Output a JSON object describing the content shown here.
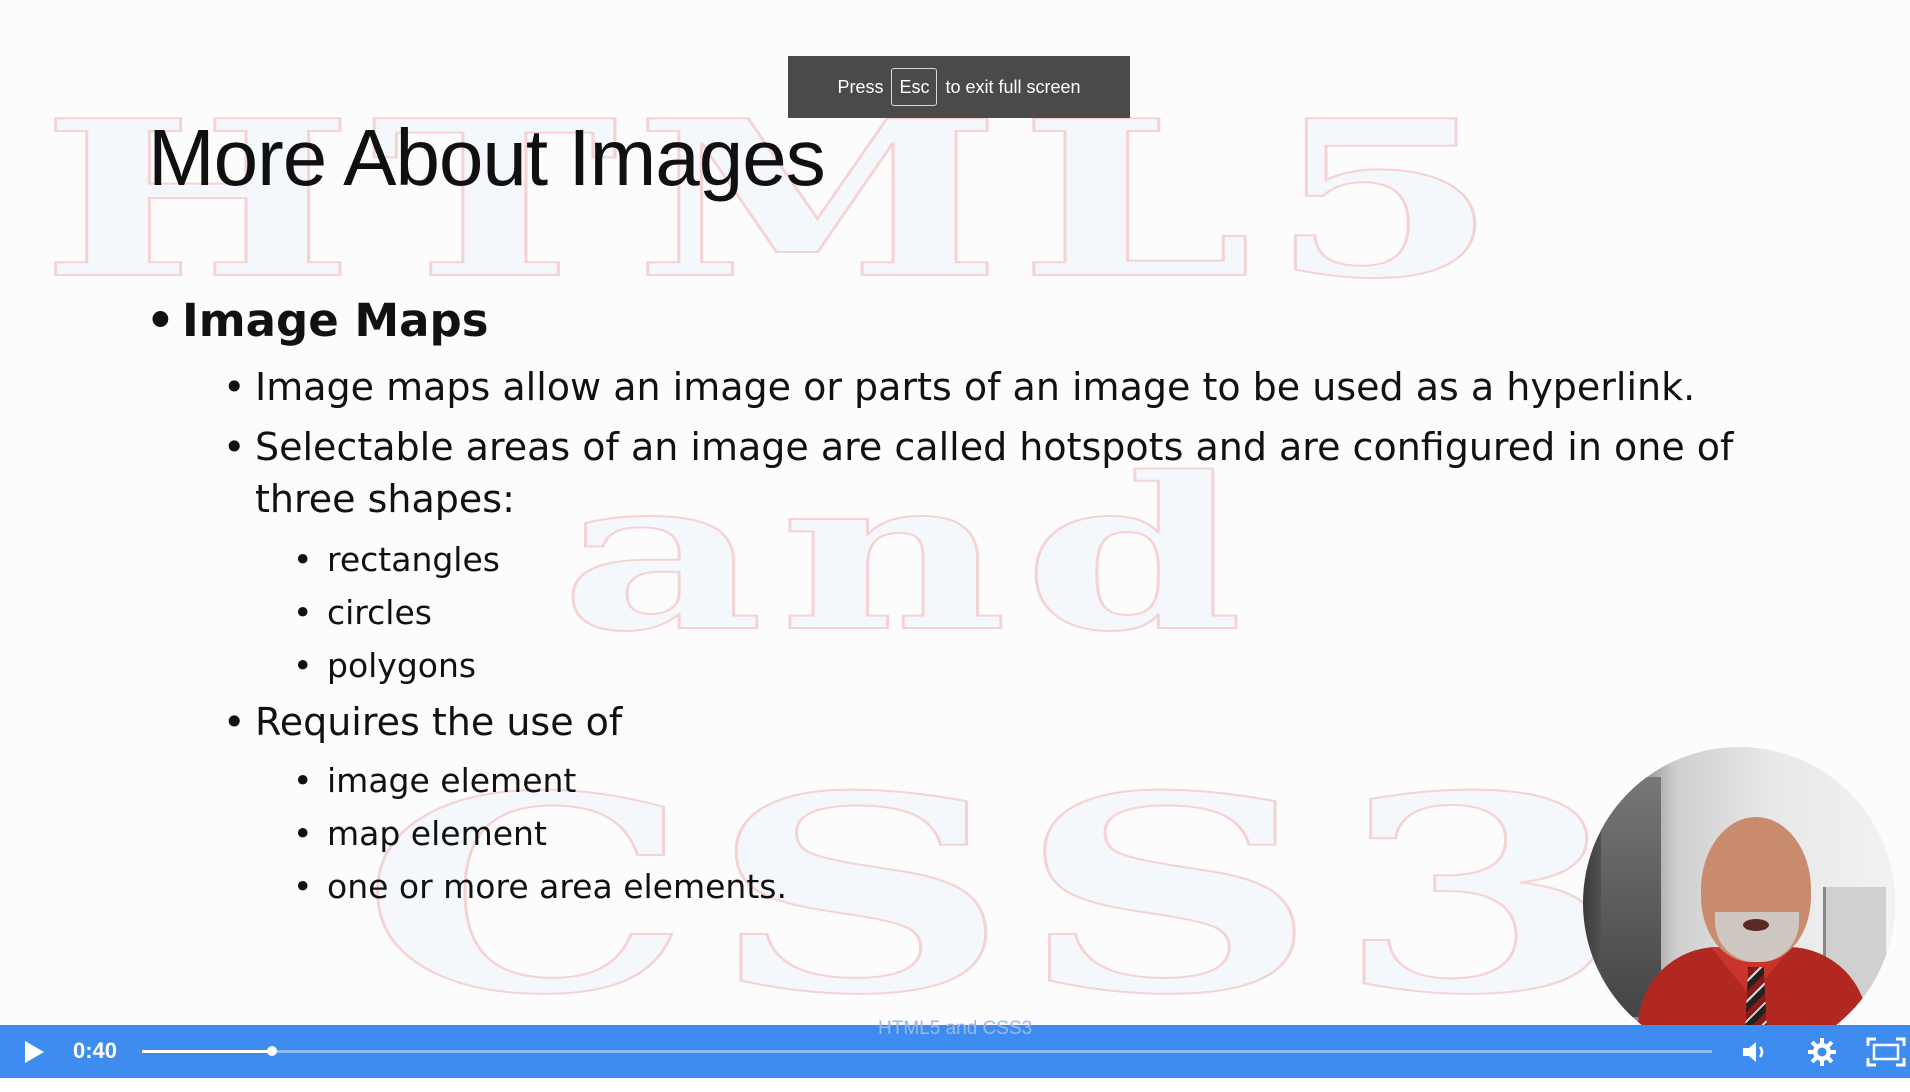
{
  "slide": {
    "watermark": {
      "line1": "HTML5",
      "line2": "and",
      "line3": "CSS3"
    },
    "title": "More About Images",
    "bullets": [
      {
        "level": 1,
        "text": "Image Maps"
      },
      {
        "level": 2,
        "text": "Image maps allow an image or parts of an image to be used as a hyperlink."
      },
      {
        "level": 2,
        "text": "Selectable areas of an image are called hotspots and are configured in one of"
      },
      {
        "level": 2,
        "text": "three shapes:",
        "continuation": true
      },
      {
        "level": 3,
        "text": "rectangles"
      },
      {
        "level": 3,
        "text": "circles"
      },
      {
        "level": 3,
        "text": "polygons"
      },
      {
        "level": 2,
        "text": "Requires the use of"
      },
      {
        "level": 3,
        "text": "image element"
      },
      {
        "level": 3,
        "text": "map element"
      },
      {
        "level": 3,
        "text": "one or more area elements."
      }
    ],
    "footer": "HTML5 and CSS3"
  },
  "fullscreen_toast": {
    "prefix": "Press",
    "key": "Esc",
    "suffix": "to exit full screen"
  },
  "player": {
    "current_time": "0:40",
    "progress": 0.0825,
    "accent_color": "#3f8cf0",
    "icons": {
      "play": "play-icon",
      "volume": "volume-icon",
      "settings": "gear-icon",
      "fullscreen": "fullscreen-icon"
    }
  }
}
